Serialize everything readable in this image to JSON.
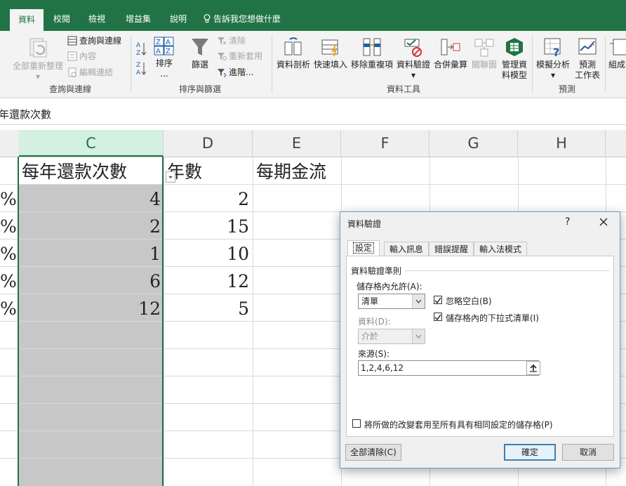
{
  "tabs": [
    "資料",
    "校閱",
    "檢視",
    "增益集",
    "說明"
  ],
  "tell_me": "告訴我您想做什麼",
  "ribbon": {
    "refresh_all": [
      "全部重新整理"
    ],
    "query_connections": "查詢與連線",
    "properties": "內容",
    "edit_links": "編輯連結",
    "group_queries": "查詢與連線",
    "sort_az": "A→Z",
    "sort": "排序",
    "sort_dots": "...",
    "filter": "篩選",
    "clear": "清除",
    "reapply": "重新套用",
    "advanced": "進階...",
    "group_sort": "排序與篩選",
    "text_to_columns": "資料剖析",
    "flash_fill": "快速填入",
    "remove_duplicates": "移除重複項",
    "data_validation": "資料驗證",
    "consolidate": "合併彙算",
    "relationships": "關聯圖",
    "manage_model": [
      "管理資",
      "料模型"
    ],
    "group_tools": "資料工具",
    "what_if": "模擬分析",
    "forecast": [
      "預測",
      "工作表"
    ],
    "group_forecast": "預測",
    "outline": "組成"
  },
  "formula_bar_text": "年還款次數",
  "columns": [
    "C",
    "D",
    "E",
    "F",
    "G",
    "H"
  ],
  "headers_row": {
    "C": "每年還款次數",
    "D": "年數",
    "E": "每期金流"
  },
  "row_prefix": "%",
  "rows": [
    {
      "C": "4",
      "D": "2"
    },
    {
      "C": "2",
      "D": "15"
    },
    {
      "C": "1",
      "D": "10"
    },
    {
      "C": "6",
      "D": "12"
    },
    {
      "C": "12",
      "D": "5"
    }
  ],
  "dialog": {
    "title": "資料驗證",
    "help": "?",
    "tabs": [
      "設定",
      "輸入訊息",
      "錯誤提醒",
      "輸入法模式"
    ],
    "section": "資料驗證準則",
    "allow_label": "儲存格內允許(A):",
    "allow_value": "清單",
    "ignore_blank": "忽略空白(B)",
    "in_cell_dropdown": "儲存格內的下拉式清單(I)",
    "data_label": "資料(D):",
    "data_value": "介於",
    "source_label": "來源(S):",
    "source_value": "1,2,4,6,12",
    "apply_all": "將所做的改變套用至所有具有相同設定的儲存格(P)",
    "clear_all": "全部清除(C)",
    "ok": "確定",
    "cancel": "取消",
    "ignore_blank_checked": true,
    "in_cell_dropdown_checked": true,
    "apply_all_checked": false
  },
  "colors": {
    "accent": "#217346",
    "selected_column": "#c7c7c7"
  }
}
